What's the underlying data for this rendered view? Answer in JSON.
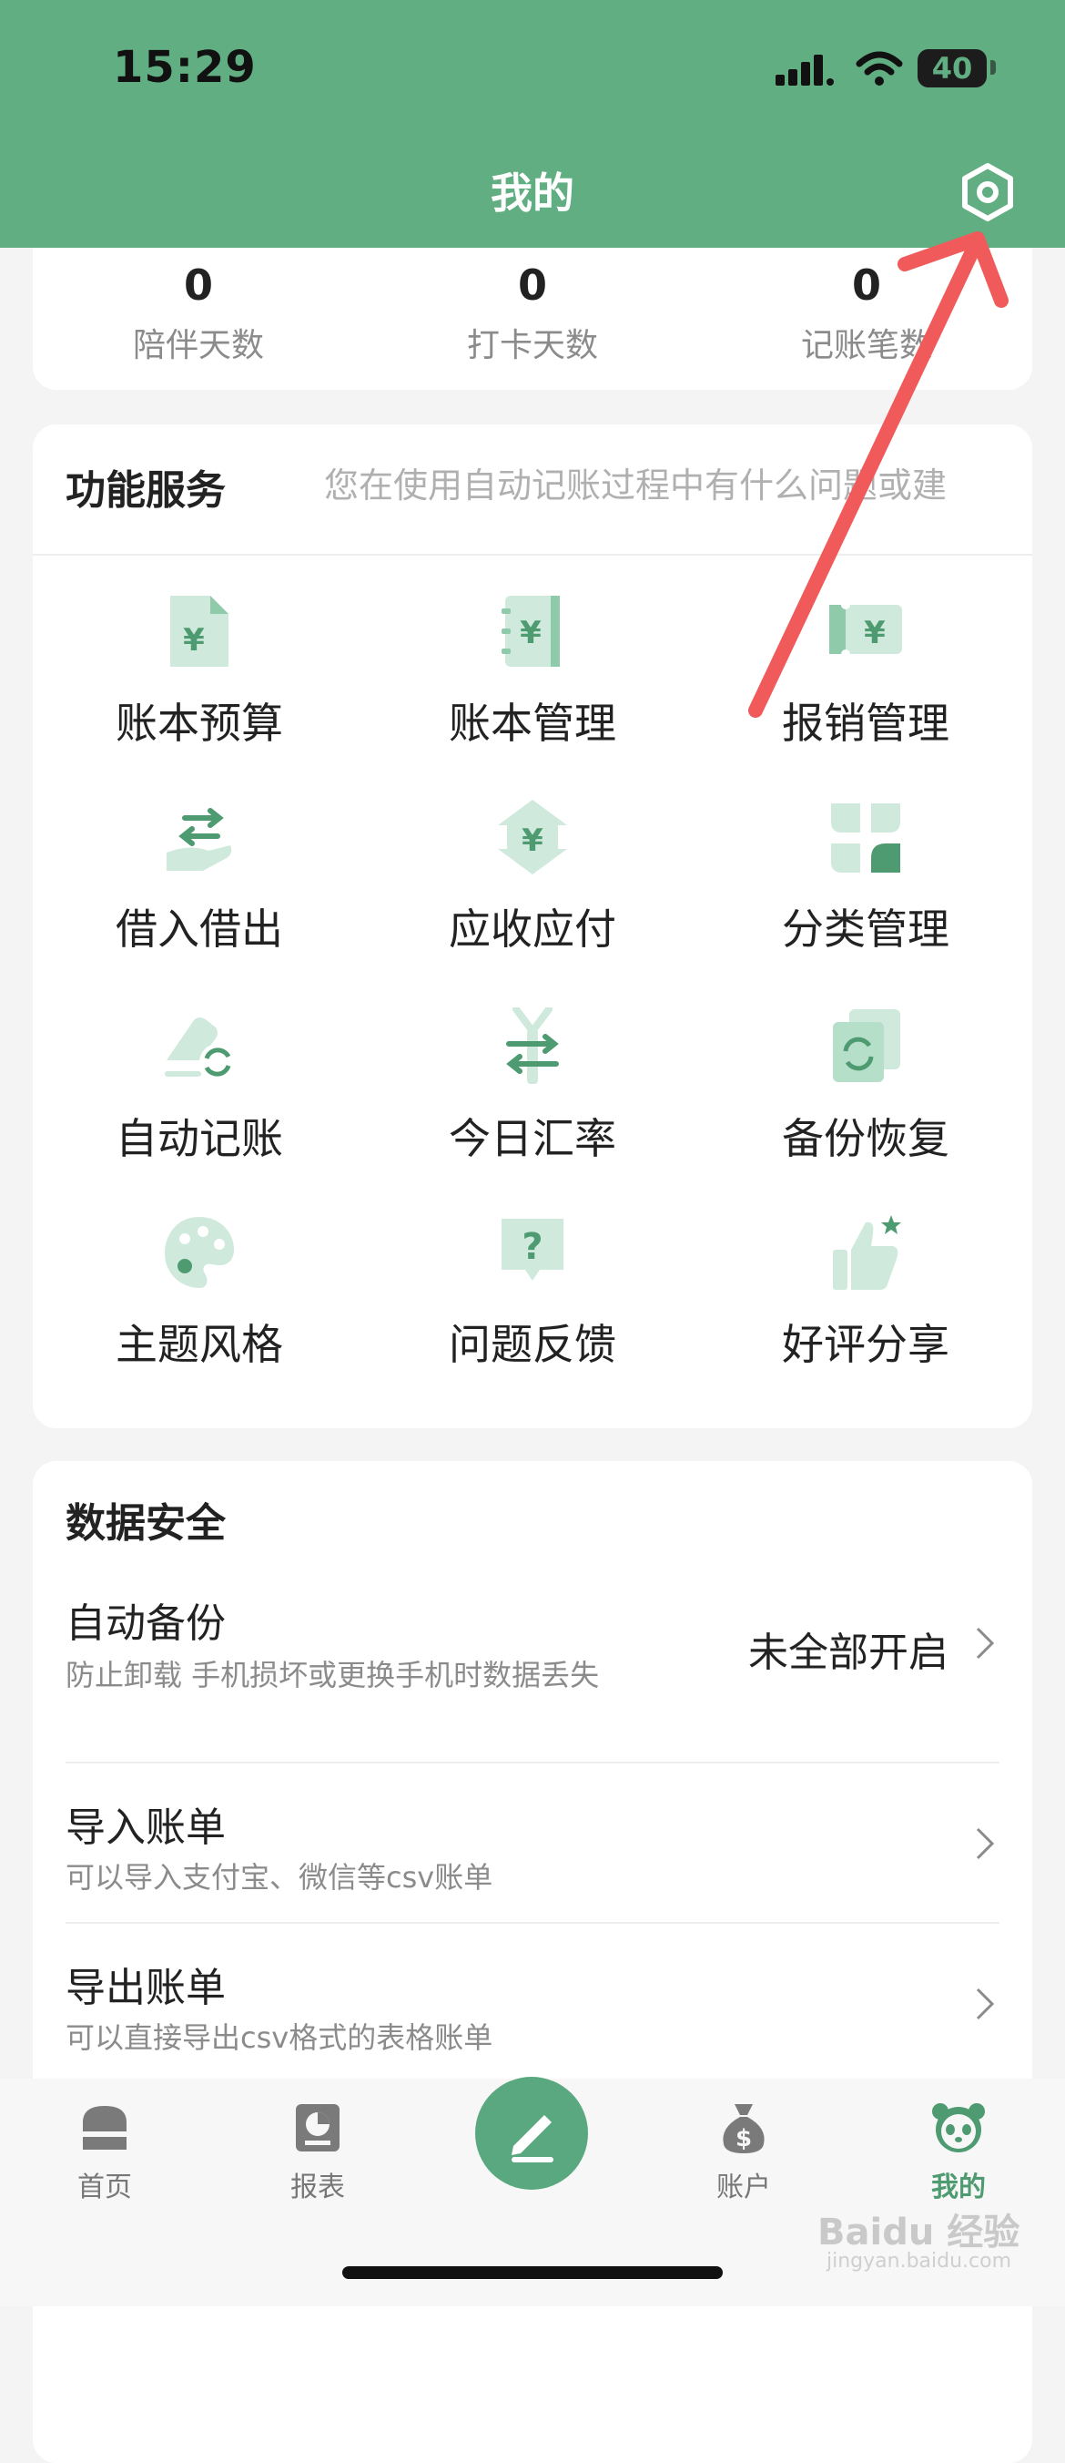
{
  "status_bar": {
    "time": "15:29",
    "battery": "40"
  },
  "header": {
    "title": "我的"
  },
  "stats": [
    {
      "value": "0",
      "label": "陪伴天数"
    },
    {
      "value": "0",
      "label": "打卡天数"
    },
    {
      "value": "0",
      "label": "记账笔数"
    }
  ],
  "services": {
    "title": "功能服务",
    "marquee": "您在使用自动记账过程中有什么问题或建",
    "items": [
      {
        "label": "账本预算",
        "icon": "budget-book-icon"
      },
      {
        "label": "账本管理",
        "icon": "book-manage-icon"
      },
      {
        "label": "报销管理",
        "icon": "reimbursement-ticket-icon"
      },
      {
        "label": "借入借出",
        "icon": "lend-borrow-icon"
      },
      {
        "label": "应收应付",
        "icon": "receivable-payable-icon"
      },
      {
        "label": "分类管理",
        "icon": "category-icon"
      },
      {
        "label": "自动记账",
        "icon": "auto-record-icon"
      },
      {
        "label": "今日汇率",
        "icon": "exchange-rate-icon"
      },
      {
        "label": "备份恢复",
        "icon": "backup-restore-icon"
      },
      {
        "label": "主题风格",
        "icon": "palette-icon"
      },
      {
        "label": "问题反馈",
        "icon": "feedback-icon"
      },
      {
        "label": "好评分享",
        "icon": "thumbs-up-icon"
      }
    ]
  },
  "security": {
    "title": "数据安全",
    "rows": [
      {
        "title": "自动备份",
        "subtitle": "防止卸载 手机损坏或更换手机时数据丢失",
        "value": "未全部开启"
      },
      {
        "title": "导入账单",
        "subtitle": "可以导入支付宝、微信等csv账单",
        "value": ""
      },
      {
        "title": "导出账单",
        "subtitle": "可以直接导出csv格式的表格账单",
        "value": ""
      }
    ]
  },
  "tabbar": [
    {
      "label": "首页",
      "icon": "home-icon"
    },
    {
      "label": "报表",
      "icon": "report-icon"
    },
    {
      "label": "账户",
      "icon": "money-bag-icon"
    },
    {
      "label": "我的",
      "icon": "panda-icon"
    }
  ],
  "watermark": {
    "text": "Baidu 经验",
    "sub": "jingyan.baidu.com"
  },
  "colors": {
    "brand": "#62ae83",
    "icon": "#7fc3a0",
    "icon_light": "#d2ece0"
  }
}
